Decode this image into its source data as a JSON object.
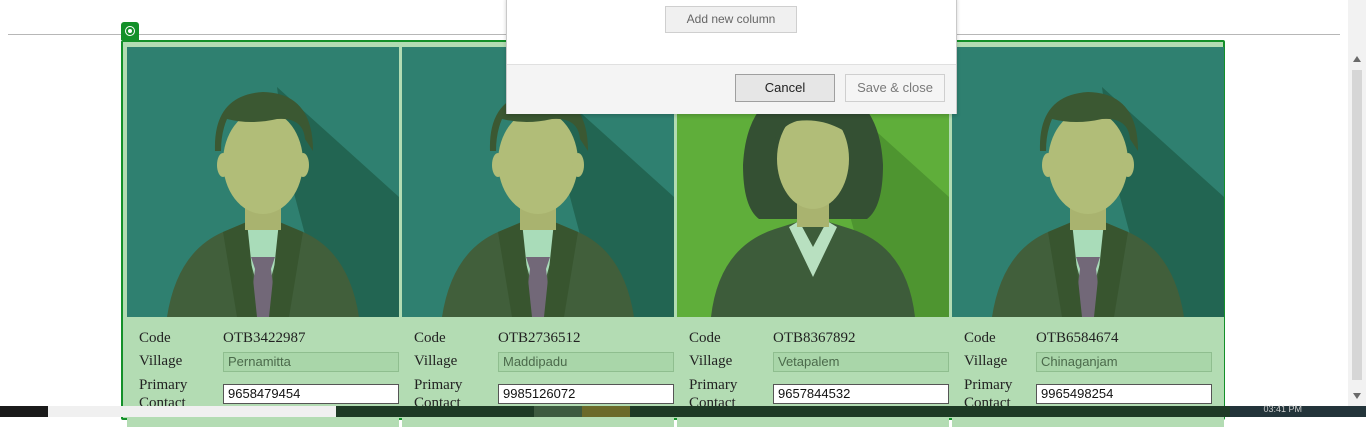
{
  "dialog": {
    "add_column_label": "Add new column",
    "cancel_label": "Cancel",
    "save_close_label": "Save & close"
  },
  "labels": {
    "code": "Code",
    "village": "Village",
    "primary": "Primary",
    "contact": "Contact"
  },
  "cards": [
    {
      "gender": "male",
      "bg": "#2f8070",
      "code": "OTB3422987",
      "village": "Pernamitta",
      "contact": "9658479454"
    },
    {
      "gender": "male",
      "bg": "#2f8070",
      "code": "OTB2736512",
      "village": "Maddipadu",
      "contact": "9985126072"
    },
    {
      "gender": "female",
      "bg": "#5fae3a",
      "code": "OTB8367892",
      "village": "Vetapalem",
      "contact": "9657844532"
    },
    {
      "gender": "male",
      "bg": "#2f8070",
      "code": "OTB6584674",
      "village": "Chinaganjam",
      "contact": "9965498254"
    }
  ],
  "taskbar": {
    "clock": "03:41 PM"
  }
}
